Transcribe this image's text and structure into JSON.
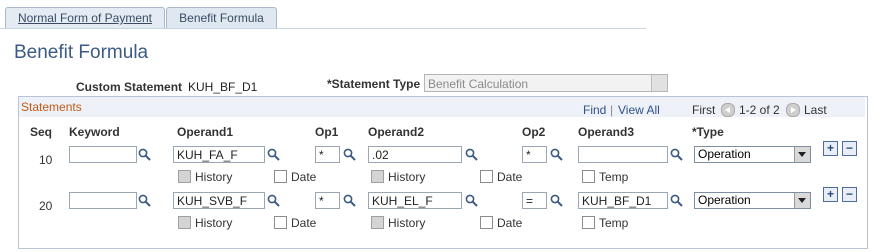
{
  "tabs": [
    {
      "label": "Normal Form of Payment",
      "active": false
    },
    {
      "label": "Benefit Formula",
      "active": true
    }
  ],
  "page_title": "Benefit Formula",
  "header": {
    "custom_statement_label": "Custom Statement",
    "custom_statement_value": "KUH_BF_D1",
    "statement_type_label": "*Statement Type",
    "statement_type_value": "Benefit Calculation"
  },
  "grid": {
    "title": "Statements",
    "find_link": "Find",
    "separator": "|",
    "view_all_link": "View All",
    "first_label": "First",
    "range_text": "1-2 of 2",
    "last_label": "Last",
    "columns": {
      "seq": "Seq",
      "keyword": "Keyword",
      "operand1": "Operand1",
      "op1": "Op1",
      "operand2": "Operand2",
      "op2": "Op2",
      "operand3": "Operand3",
      "type": "*Type"
    },
    "checkbox_labels": {
      "history": "History",
      "date": "Date",
      "temp": "Temp"
    },
    "rows": [
      {
        "seq": "10",
        "keyword": "",
        "operand1": "KUH_FA_F",
        "op1": "*",
        "operand2": ".02",
        "op2": "*",
        "operand3": "",
        "type": "Operation"
      },
      {
        "seq": "20",
        "keyword": "",
        "operand1": "KUH_SVB_F",
        "op1": "*",
        "operand2": "KUH_EL_F",
        "op2": "=",
        "operand3": "KUH_BF_D1",
        "type": "Operation"
      }
    ],
    "add_button": "+",
    "delete_button": "−"
  },
  "colors": {
    "accent": "#3b5a84",
    "grid_title": "#c05a14",
    "link": "#30518b"
  }
}
